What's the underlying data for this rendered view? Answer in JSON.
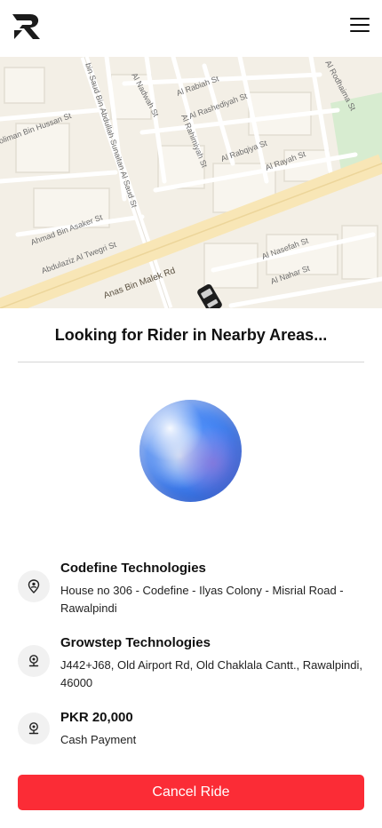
{
  "map": {
    "streets": [
      "bin Saud Bin Abdullah Sunaitan Al Saud St",
      "Al Nadwah St",
      "Al Rabiah St",
      "Al Rashediyah St",
      "Al Rahimiyah St",
      "Al Rabqiya St",
      "Al Rayah St",
      "Al Rodhaima St",
      "oliman Bin Hussan St",
      "Ahmad Bin Asaker St",
      "Abdulaziz Al Twegri St",
      "Anas Bin Malek Rd",
      "Al Nasefah St",
      "Al Nahar St"
    ]
  },
  "status": {
    "title": "Looking for Rider in Nearby Areas..."
  },
  "pickup": {
    "name": "Codefine Technologies",
    "address": "House no 306 - Codefine - Ilyas Colony - Misrial Road - Rawalpindi"
  },
  "dropoff": {
    "name": "Growstep Technologies",
    "address": "J442+J68, Old Airport Rd, Old Chaklala Cantt., Rawalpindi, 46000"
  },
  "fare": {
    "amount": "PKR 20,000",
    "method": "Cash Payment"
  },
  "actions": {
    "cancel_label": "Cancel Ride"
  },
  "colors": {
    "accent": "#fb2c36",
    "map_background": "#f3efe6",
    "major_road": "#f8e6b6"
  },
  "icons": {
    "logo": "brand-logo",
    "menu": "hamburger-menu-icon",
    "pickup": "person-pin-icon",
    "dropoff": "location-pin-icon",
    "fare": "location-pin-icon",
    "vehicle": "car-icon"
  }
}
